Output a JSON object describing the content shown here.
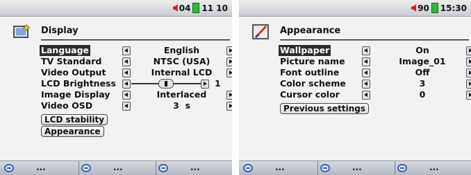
{
  "left": {
    "status": {
      "volume": "04",
      "time": "11 10"
    },
    "title": "Display",
    "rows": [
      {
        "label": "Language",
        "value": "English",
        "selected": true
      },
      {
        "label": "TV Standard",
        "value": "NTSC (USA)"
      },
      {
        "label": "Video Output",
        "value": "Internal LCD"
      },
      {
        "label": "LCD Brightness",
        "value": "1",
        "slider": true
      },
      {
        "label": "Image Display",
        "value": "Interlaced"
      },
      {
        "label": "Video OSD",
        "value": "3  s"
      }
    ],
    "buttons": [
      "LCD stability",
      "Appearance"
    ],
    "softkeys": [
      "...",
      "...",
      "..."
    ]
  },
  "right": {
    "status": {
      "volume": "90",
      "time": "15:30"
    },
    "title": "Appearance",
    "rows": [
      {
        "label": "Wallpaper",
        "value": "On",
        "selected": true
      },
      {
        "label": "Picture name",
        "value": "Image_01"
      },
      {
        "label": "Font outline",
        "value": "Off"
      },
      {
        "label": "Color scheme",
        "value": "3"
      },
      {
        "label": "Cursor color",
        "value": "0"
      }
    ],
    "buttons": [
      "Previous settings"
    ],
    "softkeys": [
      "...",
      "...",
      "..."
    ]
  }
}
